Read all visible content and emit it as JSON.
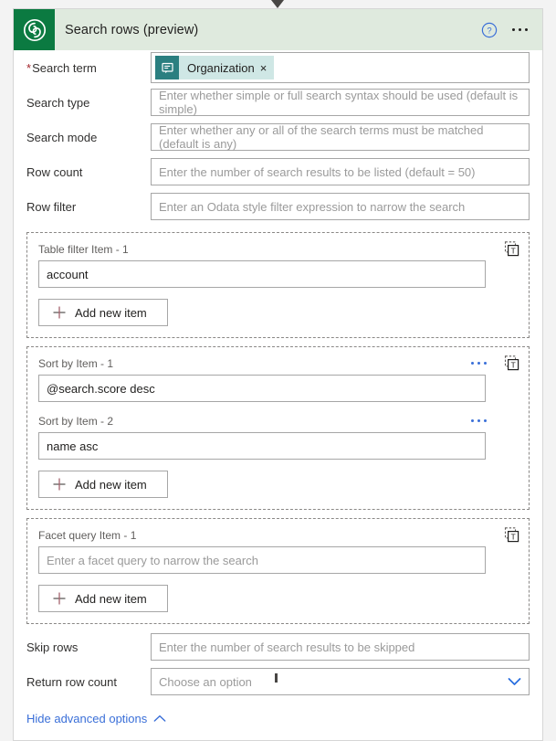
{
  "connector": {
    "top_arrow": "arrow-down-icon",
    "bottom_line": "connector-line"
  },
  "header": {
    "logo_icon": "dataverse-logo-icon",
    "title": "Search rows (preview)",
    "help_icon": "help-circle-icon",
    "more_icon": "more-horizontal-icon",
    "bg_color": "#dfeade",
    "logo_bg_color": "#0b7a41"
  },
  "fields": {
    "search_term": {
      "label": "Search term",
      "required": true,
      "token": {
        "icon": "entity-card-icon",
        "label": "Organization",
        "remove": "×",
        "icon_bg": "#2b7f80",
        "chip_bg": "#cfe7e5"
      }
    },
    "search_type": {
      "label": "Search type",
      "placeholder": "Enter whether simple or full search syntax should be used (default is simple)",
      "value": ""
    },
    "search_mode": {
      "label": "Search mode",
      "placeholder": "Enter whether any or all of the search terms must be matched (default is any)",
      "value": ""
    },
    "row_count": {
      "label": "Row count",
      "placeholder": "Enter the number of search results to be listed (default = 50)",
      "value": ""
    },
    "row_filter": {
      "label": "Row filter",
      "placeholder": "Enter an Odata style filter expression to narrow the search",
      "value": ""
    },
    "skip_rows": {
      "label": "Skip rows",
      "placeholder": "Enter the number of search results to be skipped",
      "value": ""
    },
    "return_row_count": {
      "label": "Return row count",
      "placeholder": "Choose an option",
      "value": "",
      "chevron": "chevron-down-icon"
    }
  },
  "sections": [
    {
      "key": "table_filter",
      "tool_icon": "template-text-icon",
      "add_label": "Add new item",
      "add_icon": "plus-icon",
      "items": [
        {
          "label": "Table filter Item - 1",
          "value": "account",
          "placeholder": "",
          "has_ellipsis": false
        }
      ]
    },
    {
      "key": "sort_by",
      "tool_icon": "template-text-icon",
      "add_label": "Add new item",
      "add_icon": "plus-icon",
      "items": [
        {
          "label": "Sort by Item - 1",
          "value": "@search.score desc",
          "placeholder": "",
          "has_ellipsis": true
        },
        {
          "label": "Sort by Item - 2",
          "value": "name asc",
          "placeholder": "",
          "has_ellipsis": true
        }
      ]
    },
    {
      "key": "facet_query",
      "tool_icon": "template-text-icon",
      "add_label": "Add new item",
      "add_icon": "plus-icon",
      "items": [
        {
          "label": "Facet query Item - 1",
          "value": "",
          "placeholder": "Enter a facet query to narrow the search",
          "has_ellipsis": false
        }
      ]
    }
  ],
  "advanced": {
    "label": "Hide advanced options",
    "chevron": "chevron-up-icon",
    "link_color": "#3a6fd8"
  }
}
